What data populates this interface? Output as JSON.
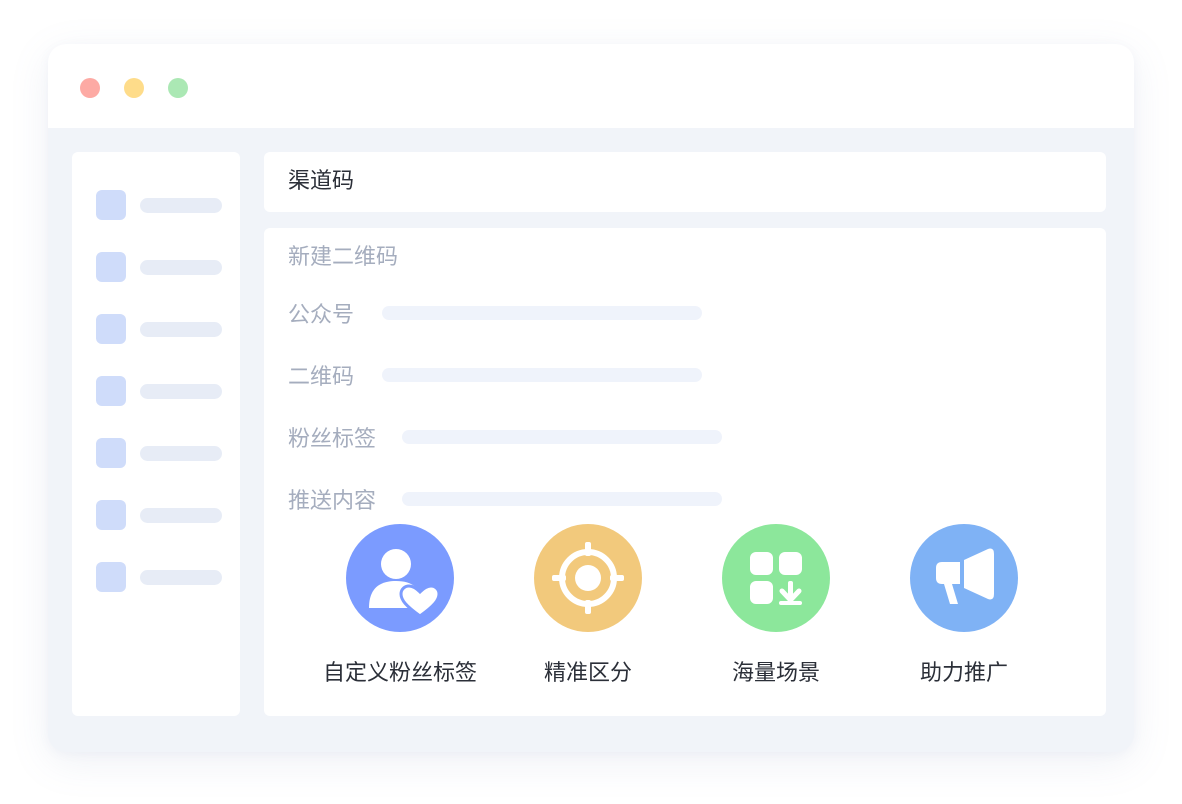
{
  "window": {
    "controls": [
      {
        "name": "close",
        "color": "#fdaaa4"
      },
      {
        "name": "minimize",
        "color": "#fedc8a"
      },
      {
        "name": "maximize",
        "color": "#abe8b4"
      }
    ]
  },
  "sidebar": {
    "item_count": 7
  },
  "header": {
    "title": "渠道码"
  },
  "main": {
    "section_title": "新建二维码",
    "fields": [
      {
        "label": "公众号"
      },
      {
        "label": "二维码"
      },
      {
        "label": "粉丝标签"
      },
      {
        "label": "推送内容"
      }
    ],
    "features": [
      {
        "label": "自定义粉丝标签",
        "icon": "user-heart-icon",
        "color": "#7b9bff"
      },
      {
        "label": "精准区分",
        "icon": "target-icon",
        "color": "#f2c97c"
      },
      {
        "label": "海量场景",
        "icon": "apps-download-icon",
        "color": "#8ce79b"
      },
      {
        "label": "助力推广",
        "icon": "megaphone-icon",
        "color": "#7fb2f5"
      }
    ]
  }
}
